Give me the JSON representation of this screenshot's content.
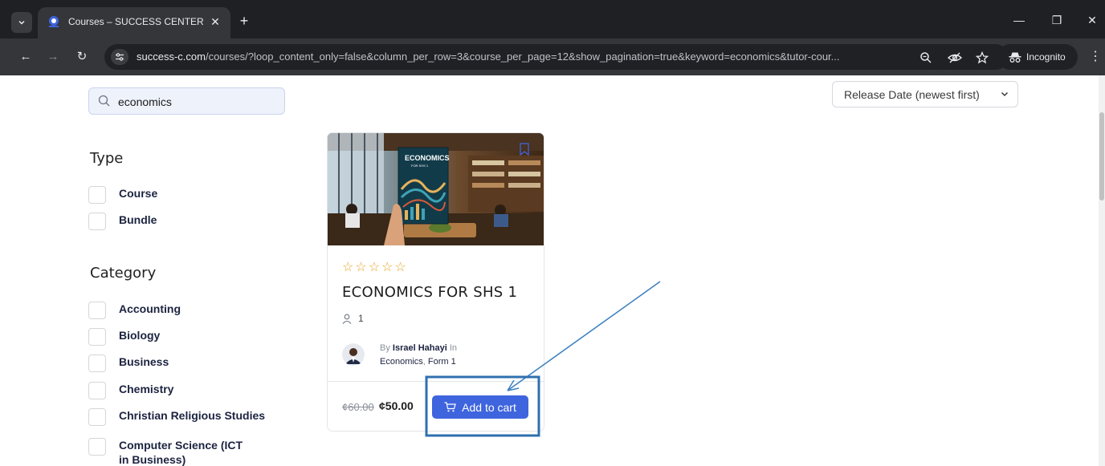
{
  "browser": {
    "tab_title": "Courses – SUCCESS CENTER",
    "url_host": "success-c.com",
    "url_path": "/courses/?loop_content_only=false&column_per_row=3&course_per_page=12&show_pagination=true&keyword=economics&tutor-cour...",
    "incognito_label": "Incognito"
  },
  "search": {
    "value": "economics"
  },
  "sort": {
    "selected": "Release Date (newest first)"
  },
  "filters": {
    "type_title": "Type",
    "type_items": [
      "Course",
      "Bundle"
    ],
    "category_title": "Category",
    "category_items": [
      "Accounting",
      "Biology",
      "Business",
      "Chemistry",
      "Christian Religious Studies",
      "Computer Science (ICT in Business)"
    ]
  },
  "course": {
    "cover_text": "ECONOMICS",
    "cover_subtext": "FOR SHS 1",
    "rating": 0,
    "title": "ECONOMICS FOR SHS 1",
    "students": "1",
    "by": "By",
    "author": "Israel Hahayi",
    "in": "In",
    "category_1": "Economics",
    "category_sep": ", ",
    "category_2": "Form 1",
    "price_old": "¢60.00",
    "price_new": "¢50.00",
    "add_to_cart": "Add to cart"
  },
  "colors": {
    "accent": "#3e64de",
    "star": "#e9a425",
    "annotation": "#3a7fc1"
  }
}
